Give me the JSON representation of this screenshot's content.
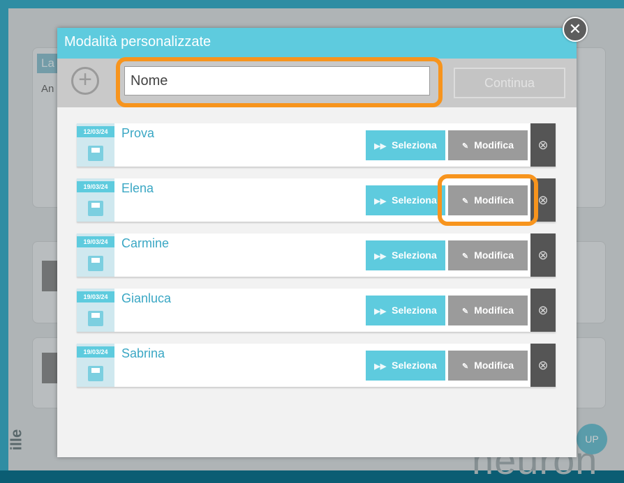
{
  "background": {
    "panel_tab": "La",
    "panel_text": "An",
    "side_text": "ille",
    "logo_text": "neuron",
    "logo_badge": "UP"
  },
  "modal": {
    "title": "Modalità personalizzate",
    "close_icon": "close-icon",
    "toolbar": {
      "add_icon": "plus-circle-icon",
      "name_placeholder": "Nome",
      "continue_label": "Continua"
    },
    "entries": [
      {
        "date": "12/03/24",
        "name": "Prova",
        "select_label": "Seleziona",
        "modify_label": "Modifica"
      },
      {
        "date": "19/03/24",
        "name": "Elena",
        "select_label": "Seleziona",
        "modify_label": "Modifica"
      },
      {
        "date": "19/03/24",
        "name": "Carmine",
        "select_label": "Seleziona",
        "modify_label": "Modifica"
      },
      {
        "date": "19/03/24",
        "name": "Gianluca",
        "select_label": "Seleziona",
        "modify_label": "Modifica"
      },
      {
        "date": "19/03/24",
        "name": "Sabrina",
        "select_label": "Seleziona",
        "modify_label": "Modifica"
      }
    ]
  },
  "colors": {
    "accent": "#5ecbde",
    "highlight": "#f7941d",
    "modify_button": "#9b9b9b",
    "delete_button": "#555555"
  }
}
